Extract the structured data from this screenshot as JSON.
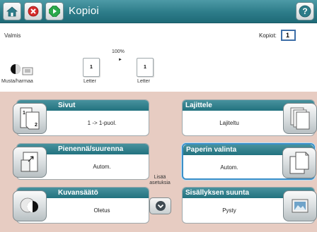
{
  "header": {
    "title": "Kopioi",
    "home_icon": "home-icon",
    "stop_icon": "stop-icon",
    "start_icon": "start-icon",
    "help_icon": "help-icon",
    "help_glyph": "?",
    "colors": {
      "bar": "#2d7c89",
      "stop": "#d62b2b",
      "start": "#2aa84a"
    }
  },
  "status": {
    "text": "Valmis",
    "copies_label": "Kopiot:",
    "copies_value": "1"
  },
  "preview": {
    "zoom": "100%",
    "input_pages": "1",
    "output_pages": "1",
    "input_paper": "Letter",
    "output_paper": "Letter",
    "color_mode": "Musta/harmaa",
    "arrow": "►"
  },
  "tiles": {
    "sides": {
      "label": "Sivut",
      "value": "1 -> 1-puol."
    },
    "collate": {
      "label": "Lajittele",
      "value": "Lajiteltu"
    },
    "reduce_enlarge": {
      "label": "Pienennä/suurenna",
      "value": "Autom."
    },
    "paper_select": {
      "label": "Paperin valinta",
      "value": "Autom."
    },
    "image_adjust": {
      "label": "Kuvansäätö",
      "value": "Oletus"
    },
    "orientation": {
      "label": "Sisällyksen suunta",
      "value": "Pysty"
    }
  },
  "more": {
    "label": "Lisää asetuksia",
    "icon": "chevron-down-icon"
  }
}
